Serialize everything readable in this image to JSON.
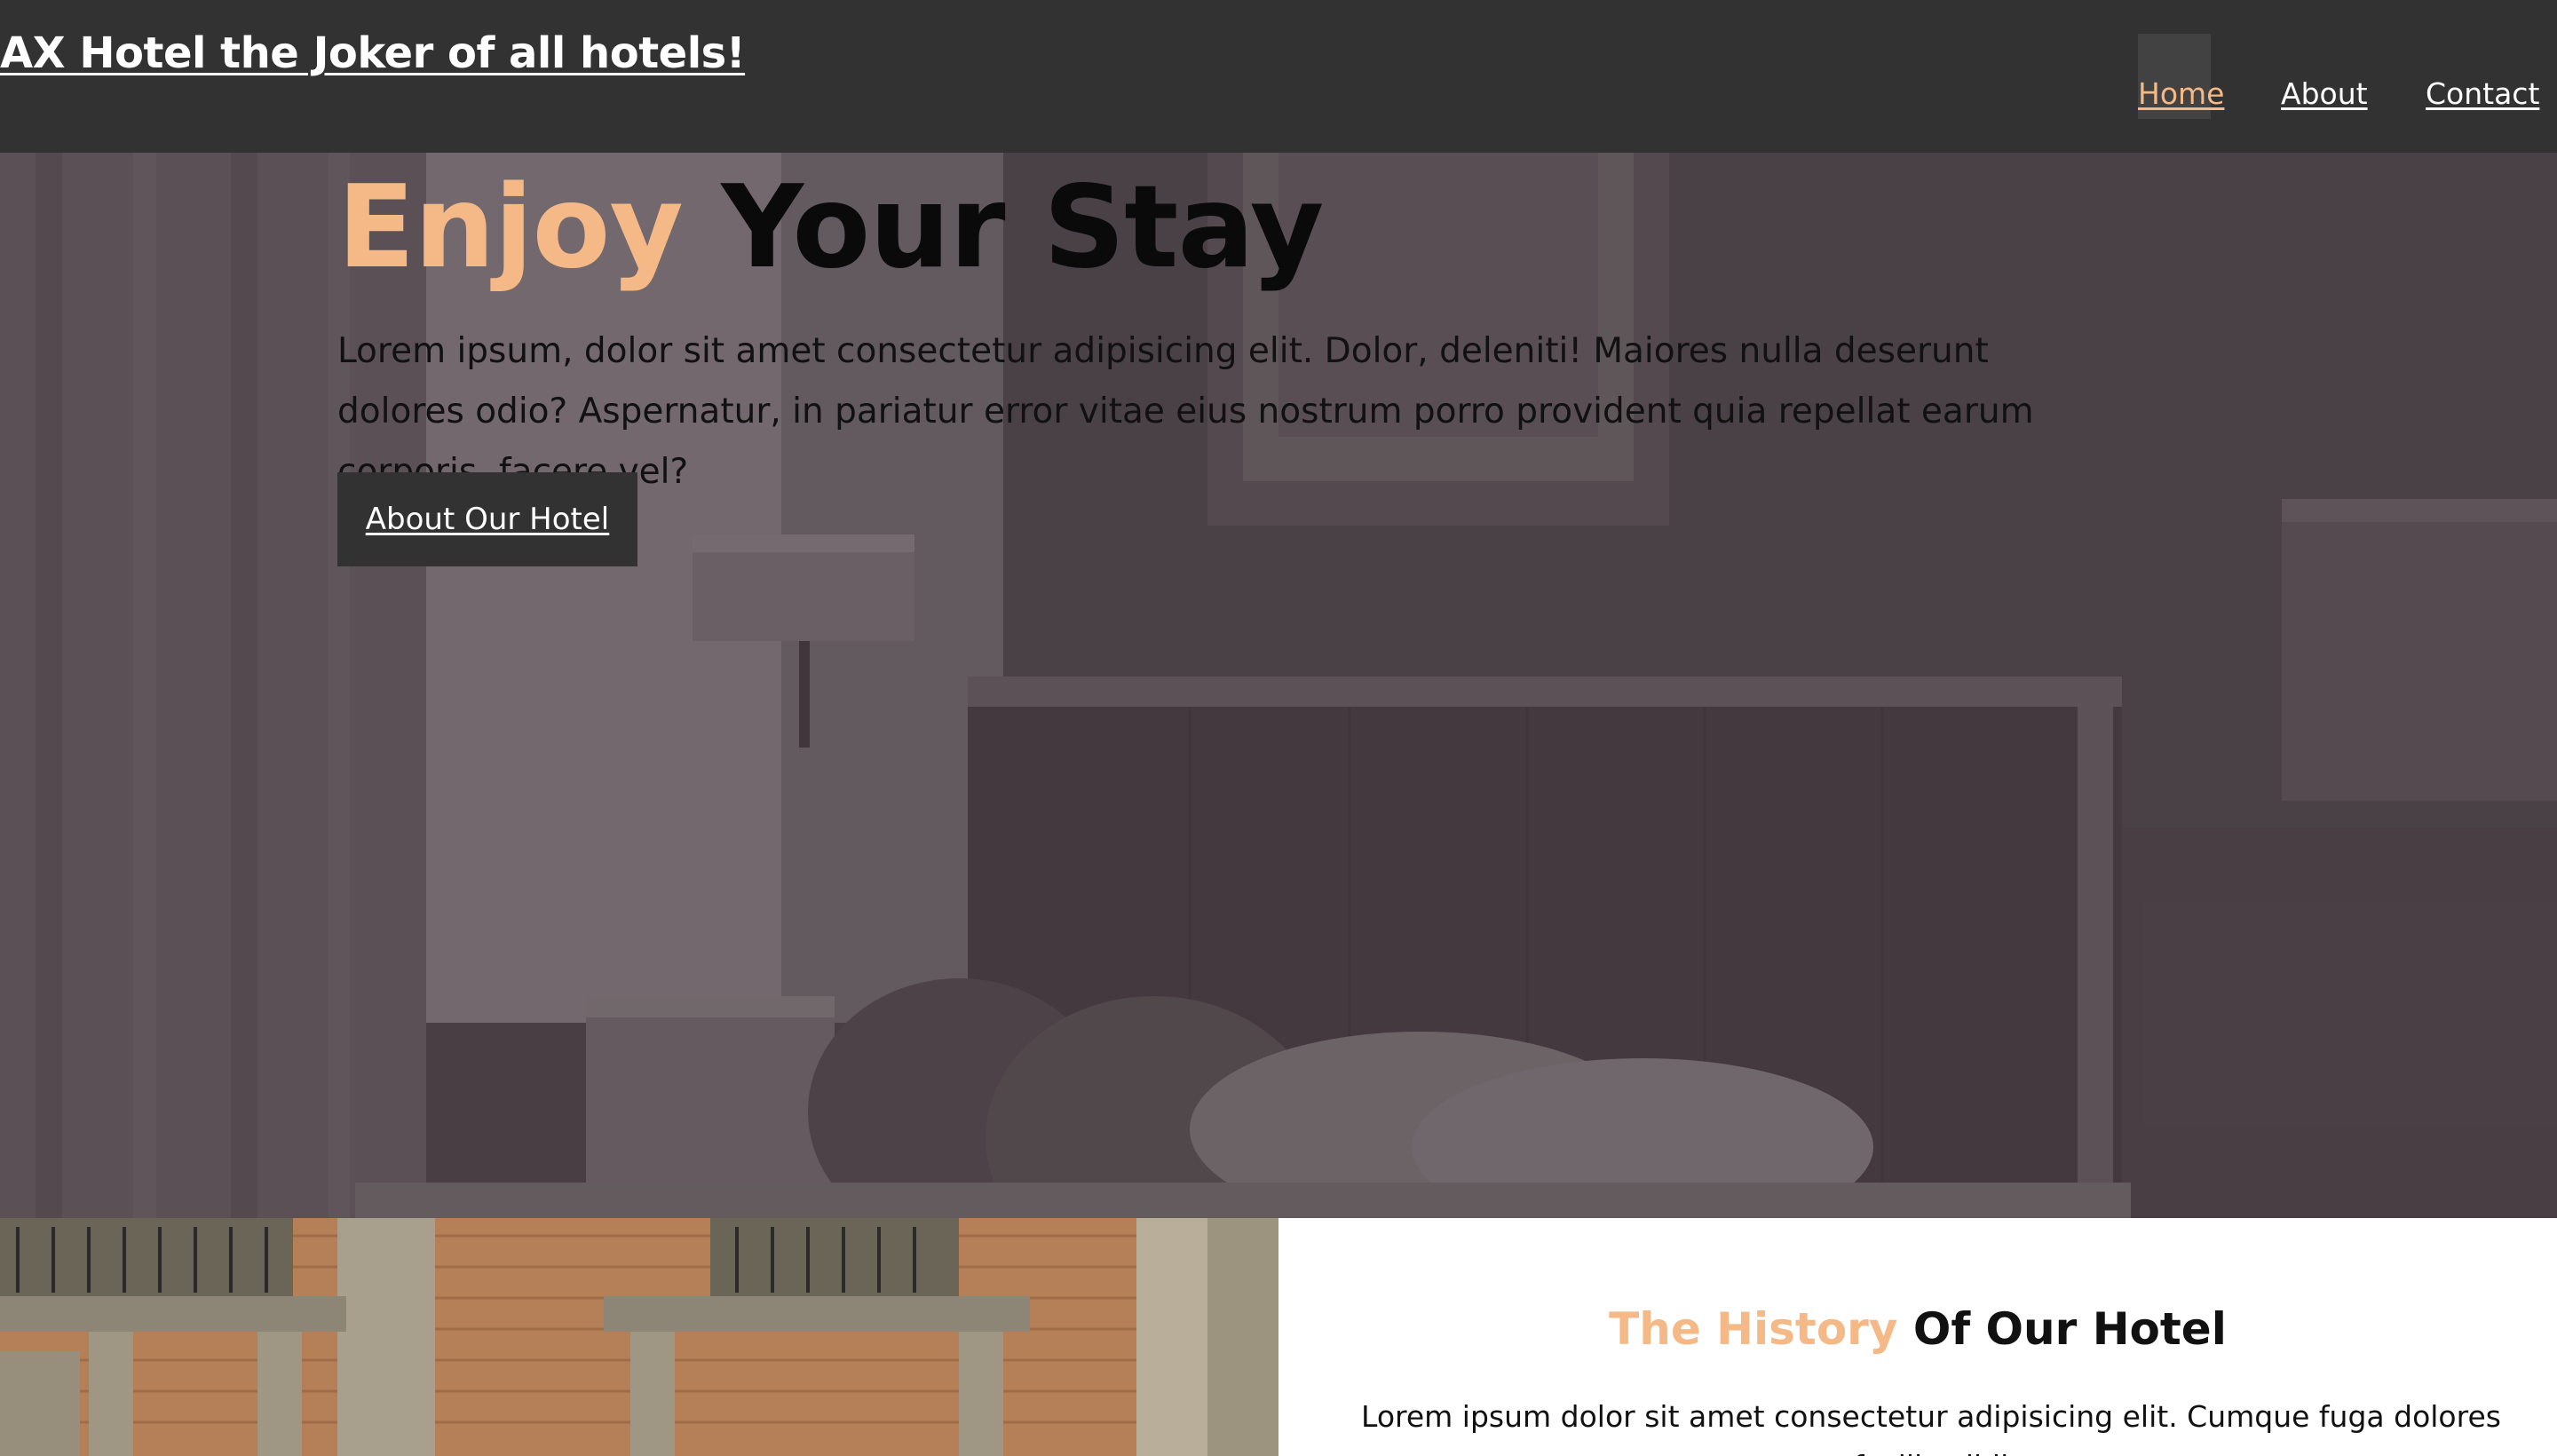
{
  "header": {
    "site_title": "AX Hotel the Joker of all hotels!",
    "nav": {
      "home": "Home",
      "about": "About",
      "contact": "Contact"
    },
    "active_nav": "Home"
  },
  "hero": {
    "title_accent": "Enjoy",
    "title_rest": "Your Stay",
    "text": "Lorem ipsum, dolor sit amet consectetur adipisicing elit. Dolor, deleniti! Maiores nulla deserunt dolores odio? Aspernatur, in pariatur error vitae eius nostrum porro provident quia repellat earum corporis, facere vel?",
    "button_label": "About Our Hotel"
  },
  "history": {
    "title_accent": "The History",
    "title_rest": "Of Our Hotel",
    "text": "Lorem ipsum dolor sit amet consectetur adipisicing elit. Cumque fuga dolores facilis nihil"
  },
  "colors": {
    "accent": "#f4b986",
    "navbar": "#333232",
    "button": "#333232"
  }
}
